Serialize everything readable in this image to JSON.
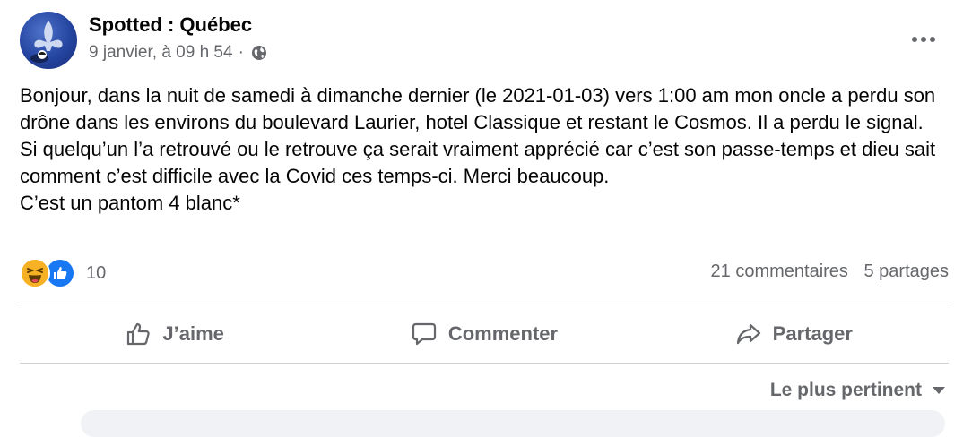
{
  "post": {
    "page_name": "Spotted : Québec",
    "timestamp": "9 janvier, à 09 h 54",
    "separator": "·",
    "privacy_icon": "globe-icon",
    "more_icon": "more-options-icon",
    "more_label": "•••",
    "text_lines": [
      "Bonjour, dans la nuit de samedi à dimanche dernier (le 2021-01-03) vers 1:00 am mon oncle a perdu son drône dans les environs du boulevard Laurier, hotel Classique et restant le Cosmos. Il a perdu le signal. Si quelqu’un l’a retrouvé ou le retrouve ça serait vraiment apprécié car c’est son passe-temps et dieu sait comment c’est difficile avec la Covid ces temps-ci. Merci beaucoup.",
      "C’est un pantom 4 blanc*"
    ]
  },
  "engagement": {
    "reaction_icons": [
      "haha-icon",
      "like-icon"
    ],
    "reaction_count": "10",
    "comments": "21 commentaires",
    "shares": "5 partages"
  },
  "actions": {
    "like": "J’aime",
    "comment": "Commenter",
    "share": "Partager"
  },
  "comments_sort": {
    "label": "Le plus pertinent"
  },
  "colors": {
    "text": "#050505",
    "secondary": "#65676b",
    "like_blue": "#1877f2",
    "haha_yellow": "#f7b125",
    "divider": "#ced0d4"
  }
}
